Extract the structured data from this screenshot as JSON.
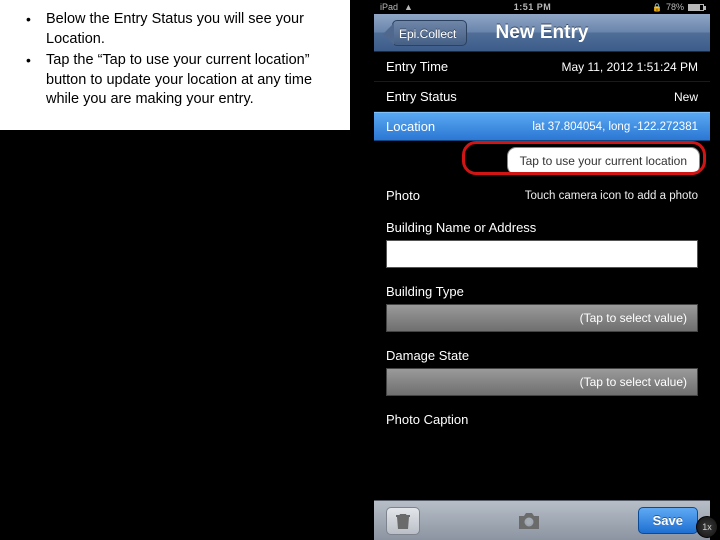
{
  "instructions": {
    "b1": "Below the Entry Status you will see your Location.",
    "b2": "Tap the “Tap to use your current location” button to update your location at any time while you are making your entry."
  },
  "statusbar": {
    "device": "iPad",
    "wifi": "◆",
    "time": "1:51 PM",
    "battery_pct": "78%",
    "lock": "🔒"
  },
  "nav": {
    "back": "Epi.Collect",
    "title": "New Entry"
  },
  "entry": {
    "time_label": "Entry Time",
    "time_value": "May 11, 2012 1:51:24 PM",
    "status_label": "Entry Status",
    "status_value": "New",
    "location_label": "Location",
    "location_value": "lat 37.804054, long -122.272381",
    "location_btn": "Tap to use your current location",
    "photo_label": "Photo",
    "photo_hint": "Touch camera icon to add a photo",
    "building_name_label": "Building Name or Address",
    "building_type_label": "Building Type",
    "select_placeholder": "(Tap to select value)",
    "damage_state_label": "Damage State",
    "photo_caption_label": "Photo Caption"
  },
  "toolbar": {
    "save": "Save"
  },
  "zoom": "1x"
}
